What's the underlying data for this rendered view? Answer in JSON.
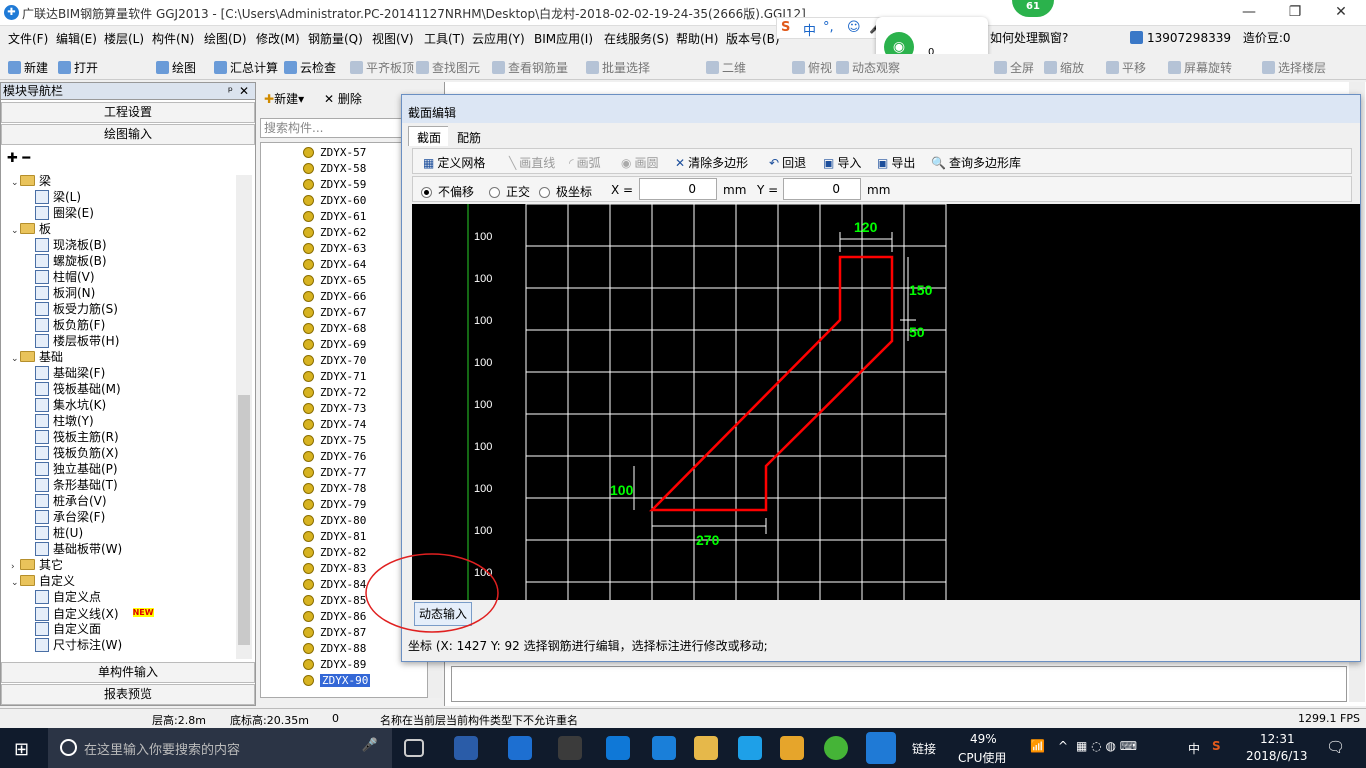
{
  "window": {
    "title": "广联达BIM钢筋算量软件 GGJ2013 - [C:\\Users\\Administrator.PC-20141127NRHM\\Desktop\\白龙村-2018-02-02-19-24-35(2666版).GGJ12]",
    "badge_count": "61"
  },
  "menu": [
    "文件(F)",
    "编辑(E)",
    "楼层(L)",
    "构件(N)",
    "绘图(D)",
    "修改(M)",
    "钢筋量(Q)",
    "视图(V)",
    "工具(T)",
    "云应用(Y)",
    "BIM应用(I)",
    "在线服务(S)",
    "帮助(H)",
    "版本号(B)"
  ],
  "ime": {
    "lang": "中",
    "punct": "°,"
  },
  "floating": {
    "question": "如何处理飘窗?",
    "count": "0"
  },
  "user": {
    "phone": "13907298339",
    "price": "造价豆:0"
  },
  "toolbar": [
    {
      "label": "新建",
      "icon": "new-icon",
      "dim": false
    },
    {
      "label": "打开",
      "icon": "open-icon",
      "dim": false
    },
    {
      "label": "绘图",
      "icon": "draw-icon",
      "dim": false
    },
    {
      "label": "汇总计算",
      "icon": "sum-icon",
      "dim": false
    },
    {
      "label": "云检查",
      "icon": "cloud-check-icon",
      "dim": false
    },
    {
      "label": "平齐板顶",
      "icon": "align-icon",
      "dim": true
    },
    {
      "label": "查找图元",
      "icon": "find-icon",
      "dim": true
    },
    {
      "label": "查看钢筋量",
      "icon": "view-rebar-icon",
      "dim": true
    },
    {
      "label": "批量选择",
      "icon": "batch-icon",
      "dim": true
    },
    {
      "label": "二维",
      "icon": "2d-icon",
      "dim": true
    },
    {
      "label": "俯视",
      "icon": "topview-icon",
      "dim": true
    },
    {
      "label": "动态观察",
      "icon": "orbit-icon",
      "dim": true
    },
    {
      "label": "全屏",
      "icon": "fullscreen-icon",
      "dim": true
    },
    {
      "label": "缩放",
      "icon": "zoom-icon",
      "dim": true
    },
    {
      "label": "平移",
      "icon": "pan-icon",
      "dim": true
    },
    {
      "label": "屏幕旋转",
      "icon": "rotate-icon",
      "dim": true
    },
    {
      "label": "选择楼层",
      "icon": "floor-icon",
      "dim": true
    }
  ],
  "nav": {
    "title": "模块导航栏",
    "project_settings": "工程设置",
    "draw_input": "绘图输入",
    "single_input": "单构件输入",
    "report_preview": "报表预览",
    "tree": [
      {
        "label": "梁",
        "level": 0,
        "folder": true
      },
      {
        "label": "梁(L)",
        "level": 1
      },
      {
        "label": "圈梁(E)",
        "level": 1
      },
      {
        "label": "板",
        "level": 0,
        "folder": true
      },
      {
        "label": "现浇板(B)",
        "level": 1
      },
      {
        "label": "螺旋板(B)",
        "level": 1
      },
      {
        "label": "柱帽(V)",
        "level": 1
      },
      {
        "label": "板洞(N)",
        "level": 1
      },
      {
        "label": "板受力筋(S)",
        "level": 1
      },
      {
        "label": "板负筋(F)",
        "level": 1
      },
      {
        "label": "楼层板带(H)",
        "level": 1
      },
      {
        "label": "基础",
        "level": 0,
        "folder": true
      },
      {
        "label": "基础梁(F)",
        "level": 1
      },
      {
        "label": "筏板基础(M)",
        "level": 1
      },
      {
        "label": "集水坑(K)",
        "level": 1
      },
      {
        "label": "柱墩(Y)",
        "level": 1
      },
      {
        "label": "筏板主筋(R)",
        "level": 1
      },
      {
        "label": "筏板负筋(X)",
        "level": 1
      },
      {
        "label": "独立基础(P)",
        "level": 1
      },
      {
        "label": "条形基础(T)",
        "level": 1
      },
      {
        "label": "桩承台(V)",
        "level": 1
      },
      {
        "label": "承台梁(F)",
        "level": 1
      },
      {
        "label": "桩(U)",
        "level": 1
      },
      {
        "label": "基础板带(W)",
        "level": 1
      },
      {
        "label": "其它",
        "level": 0,
        "folder": true,
        "collapsed": true
      },
      {
        "label": "自定义",
        "level": 0,
        "folder": true
      },
      {
        "label": "自定义点",
        "level": 1
      },
      {
        "label": "自定义线(X)",
        "level": 1,
        "badge": "NEW"
      },
      {
        "label": "自定义面",
        "level": 1
      },
      {
        "label": "尺寸标注(W)",
        "level": 1
      }
    ]
  },
  "mid": {
    "new_label": "新建",
    "delete_label": "删除",
    "search_placeholder": "搜索构件...",
    "items": [
      "ZDYX-57",
      "ZDYX-58",
      "ZDYX-59",
      "ZDYX-60",
      "ZDYX-61",
      "ZDYX-62",
      "ZDYX-63",
      "ZDYX-64",
      "ZDYX-65",
      "ZDYX-66",
      "ZDYX-67",
      "ZDYX-68",
      "ZDYX-69",
      "ZDYX-70",
      "ZDYX-71",
      "ZDYX-72",
      "ZDYX-73",
      "ZDYX-74",
      "ZDYX-75",
      "ZDYX-76",
      "ZDYX-77",
      "ZDYX-78",
      "ZDYX-79",
      "ZDYX-80",
      "ZDYX-81",
      "ZDYX-82",
      "ZDYX-83",
      "ZDYX-84",
      "ZDYX-85",
      "ZDYX-86",
      "ZDYX-87",
      "ZDYX-88",
      "ZDYX-89",
      "ZDYX-90"
    ],
    "selected": "ZDYX-90"
  },
  "dialog": {
    "title": "截面编辑",
    "tabs": [
      "截面",
      "配筋"
    ],
    "tools": [
      {
        "label": "定义网格",
        "dim": false
      },
      {
        "label": "画直线",
        "dim": true
      },
      {
        "label": "画弧",
        "dim": true
      },
      {
        "label": "画圆",
        "dim": true
      },
      {
        "label": "清除多边形",
        "dim": false
      },
      {
        "label": "回退",
        "dim": false
      },
      {
        "label": "导入",
        "dim": false
      },
      {
        "label": "导出",
        "dim": false
      },
      {
        "label": "查询多边形库",
        "dim": false
      }
    ],
    "offset_options": [
      "不偏移",
      "正交",
      "极坐标"
    ],
    "x_label": "X =",
    "x_value": "0",
    "y_label": "Y =",
    "y_value": "0",
    "unit": "mm",
    "grid_labels": [
      "100",
      "100",
      "100",
      "100",
      "100",
      "100",
      "100",
      "100",
      "100"
    ],
    "dims": {
      "top": "120",
      "right_a": "150",
      "right_b": "50",
      "left": "100",
      "bottom": "270"
    },
    "dynamic_input": "动态输入",
    "coord_text": "坐标 (X: 1427 Y: 92",
    "hint": "选择钢筋进行编辑，选择标注进行修改或移动;"
  },
  "status": {
    "floor_height": "层高:2.8m",
    "base_height": "底标高:20.35m",
    "zero": "0",
    "message": "名称在当前层当前构件类型下不允许重名",
    "fps": "1299.1 FPS"
  },
  "taskbar": {
    "search_placeholder": "在这里输入你要搜索的内容",
    "link": "链接",
    "cpu": "49%",
    "cpu_label": "CPU使用",
    "lang": "中",
    "time": "12:31",
    "date": "2018/6/13"
  },
  "colors": {
    "shape": "#ff0000",
    "dims": "#00ff00",
    "grid": "#ffffff",
    "canvas": "#000000"
  }
}
